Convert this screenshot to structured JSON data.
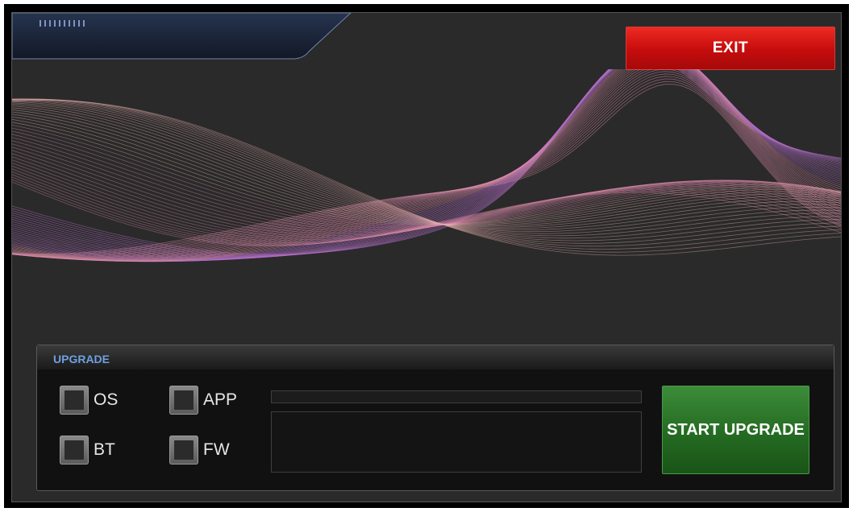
{
  "header": {
    "exit_label": "EXIT"
  },
  "upgrade": {
    "title": "UPGRADE",
    "options": [
      {
        "label": "OS",
        "checked": false
      },
      {
        "label": "APP",
        "checked": false
      },
      {
        "label": "BT",
        "checked": false
      },
      {
        "label": "FW",
        "checked": false
      }
    ],
    "progress": 0,
    "log": "",
    "start_label": "START UPGRADE"
  },
  "theme": {
    "background": "#2a2a2a",
    "exit_color": "#d01010",
    "start_color": "#2a7a28",
    "group_title_color": "#6fa0e0",
    "wave_colors": [
      "#b46fc8",
      "#d98aa8",
      "#e8b0b0"
    ]
  }
}
